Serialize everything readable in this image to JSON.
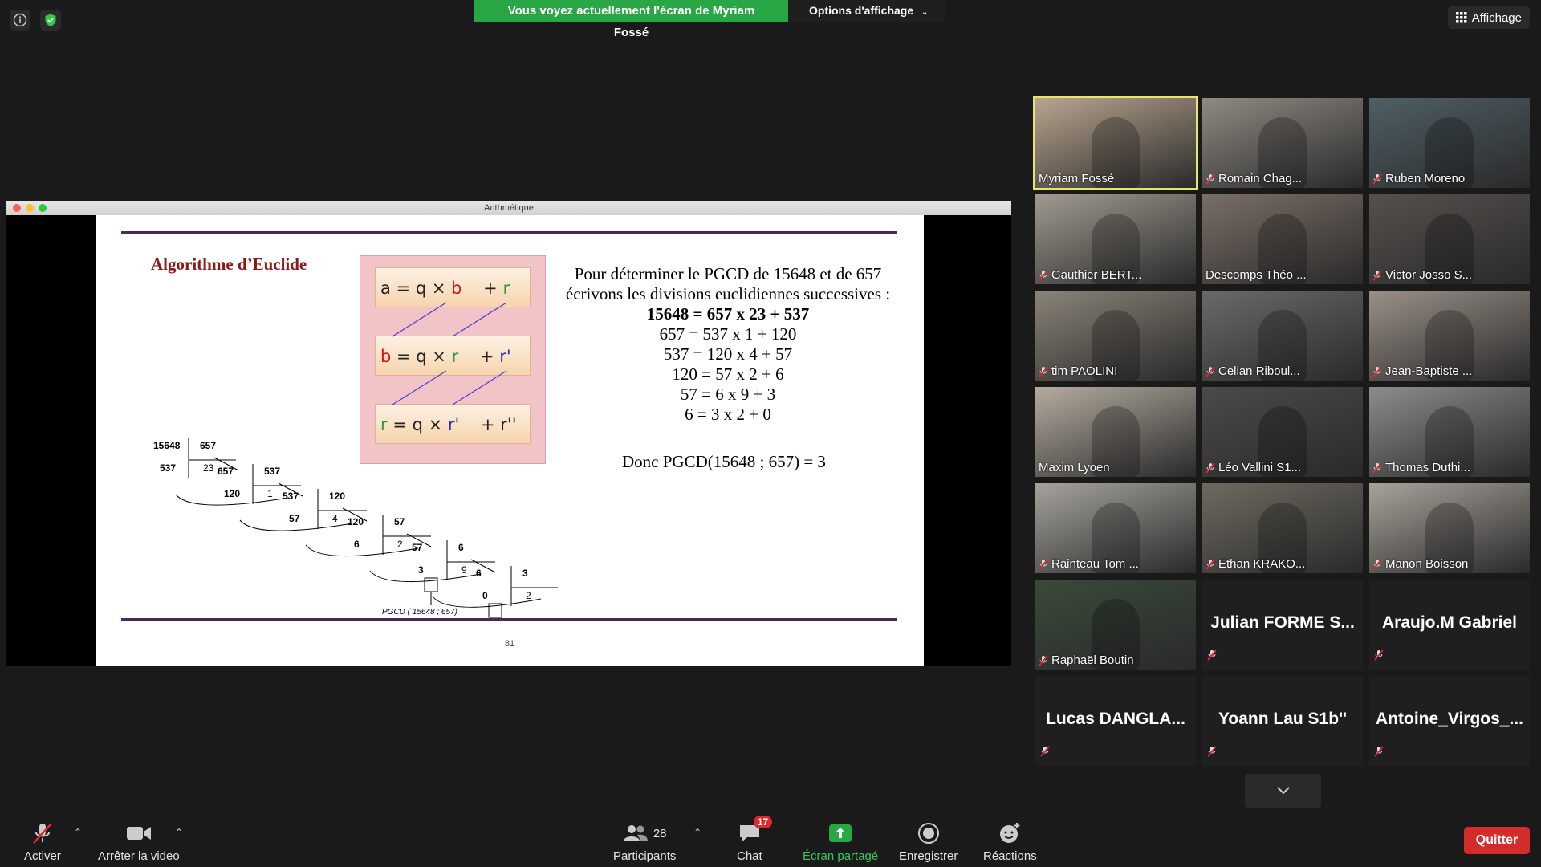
{
  "top": {
    "banner_message": "Vous voyez actuellement l'écran de Myriam Fossé",
    "display_options": "Options d'affichage",
    "view_button": "Affichage"
  },
  "share_window": {
    "title": "Arithmétique",
    "slide": {
      "title": "Algorithme d’Euclide",
      "formulas": [
        {
          "a": "a",
          "b": "b",
          "r": "r"
        },
        {
          "a": "b",
          "b": "r",
          "r": "r'"
        },
        {
          "a": "r",
          "b": "r'",
          "r": "r''"
        }
      ],
      "intro_line1": "Pour déterminer le PGCD de 15648 et de 657",
      "intro_line2": "écrivons les divisions euclidiennes successives :",
      "equations": [
        "15648 = 657 x 23 + 537",
        "657 = 537 x 1 + 120",
        "537 = 120 x 4 + 57",
        "120 = 57 x 2 + 6",
        "57 = 6 x 9 + 3",
        "6 = 3 x 2 + 0"
      ],
      "conclusion": "Donc   PGCD(15648 ; 657) = 3",
      "diagram_caption": "PGCD ( 15648 ; 657)",
      "page_number": "81",
      "divisions": [
        {
          "dividend": "15648",
          "divisor": "657",
          "remainder": "537",
          "quotient": "23"
        },
        {
          "dividend": "657",
          "divisor": "537",
          "remainder": "120",
          "quotient": "1"
        },
        {
          "dividend": "537",
          "divisor": "120",
          "remainder": "57",
          "quotient": "4"
        },
        {
          "dividend": "120",
          "divisor": "57",
          "remainder": "6",
          "quotient": "2"
        },
        {
          "dividend": "57",
          "divisor": "6",
          "remainder": "3",
          "quotient": "9"
        },
        {
          "dividend": "6",
          "divisor": "3",
          "remainder": "0",
          "quotient": "2"
        }
      ]
    }
  },
  "participants": [
    {
      "name": "Myriam Fossé",
      "video": true,
      "muted": false,
      "active": true,
      "color": "#b8a58f"
    },
    {
      "name": "Romain Chag...",
      "video": true,
      "muted": true,
      "color": "#8f8a82"
    },
    {
      "name": "Ruben Moreno",
      "video": true,
      "muted": true,
      "color": "#4f5f66"
    },
    {
      "name": "Gauthier BERT...",
      "video": true,
      "muted": true,
      "color": "#a09a90"
    },
    {
      "name": "Descomps Théo ...",
      "video": true,
      "muted": false,
      "color": "#7a6e66"
    },
    {
      "name": "Victor Josso S...",
      "video": true,
      "muted": true,
      "color": "#55504c"
    },
    {
      "name": "tim PAOLINI",
      "video": true,
      "muted": true,
      "color": "#8a8378"
    },
    {
      "name": "Celian Riboul...",
      "video": true,
      "muted": true,
      "color": "#6a6a6a"
    },
    {
      "name": "Jean-Baptiste ...",
      "video": true,
      "muted": true,
      "color": "#9a9088"
    },
    {
      "name": "Maxim Lyoen",
      "video": true,
      "muted": false,
      "color": "#b5aca0"
    },
    {
      "name": "Léo Vallini S1...",
      "video": true,
      "muted": true,
      "color": "#4a4a4a"
    },
    {
      "name": "Thomas Duthi...",
      "video": true,
      "muted": true,
      "color": "#8c8c8c"
    },
    {
      "name": "Rainteau Tom ...",
      "video": true,
      "muted": true,
      "color": "#a6a39c"
    },
    {
      "name": "Ethan KRAKO...",
      "video": true,
      "muted": true,
      "color": "#6e6a60"
    },
    {
      "name": "Manon Boisson",
      "video": true,
      "muted": true,
      "color": "#a8a29a"
    },
    {
      "name": "Raphaël Boutin",
      "video": true,
      "muted": true,
      "color": "#3a4a3a"
    },
    {
      "name": "Julian  FORME  S...",
      "video": false,
      "muted": true
    },
    {
      "name": "Araujo.M Gabriel",
      "video": false,
      "muted": true
    },
    {
      "name": "Lucas  DANGLA...",
      "video": false,
      "muted": true
    },
    {
      "name": "Yoann Lau S1b''",
      "video": false,
      "muted": true
    },
    {
      "name": "Antoine_Virgos_...",
      "video": false,
      "muted": true
    }
  ],
  "toolbar": {
    "mute_label": "Activer",
    "video_label": "Arrêter la video",
    "participants_label": "Participants",
    "participants_count": "28",
    "chat_label": "Chat",
    "chat_badge": "17",
    "share_label": "Écran partagé",
    "record_label": "Enregistrer",
    "reactions_label": "Réactions",
    "quit_label": "Quitter"
  },
  "colors": {
    "share_green": "#29a745",
    "quit_red": "#d62b2b",
    "active_speaker": "#e6e66a",
    "muted_red": "#e0262e"
  }
}
